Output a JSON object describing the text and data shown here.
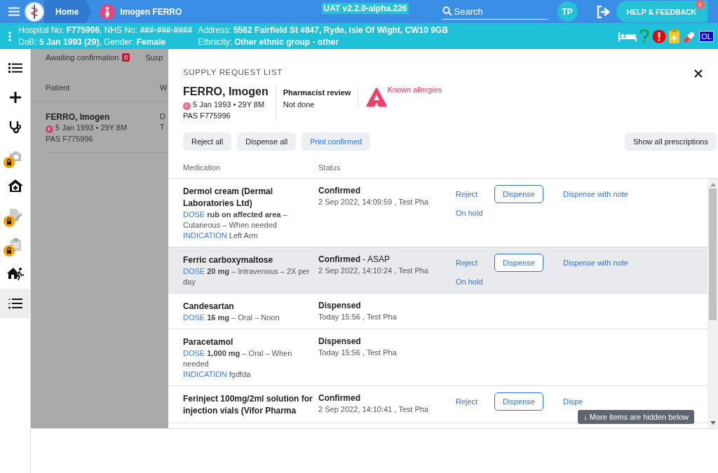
{
  "top_bar": {
    "home": "Home",
    "patient": "Imogen FERRO",
    "environment": "UAT v2.2.0-alpha.226",
    "search": {
      "placeholder": "Search"
    },
    "user_initials": "TP",
    "help_button": "HELP & FEEDBACK",
    "help_badge": "1"
  },
  "patient_banner": {
    "columns": [
      [
        "Hospital No: **F775996**, NHS No: **###-###-####**",
        "DoB: **5 Jan 1993 (29)**, Gender: **Female**"
      ],
      [
        "Address: **5562 Fairfield St #847, Ryde, Isle Of Wight, CW10 9GB**",
        "Ethnicity: **Other ethnic group - other**"
      ]
    ],
    "badge": "OL"
  },
  "sidebar": {
    "items": [
      {
        "kind": "list",
        "locked": false,
        "selected": false
      },
      {
        "kind": "plus",
        "locked": false,
        "selected": false
      },
      {
        "kind": "stethoscope",
        "locked": false,
        "selected": false
      },
      {
        "kind": "camera",
        "locked": true,
        "selected": false
      },
      {
        "kind": "hospital",
        "locked": false,
        "selected": false
      },
      {
        "kind": "edit",
        "locked": true,
        "selected": false
      },
      {
        "kind": "clipboard",
        "locked": true,
        "selected": false
      },
      {
        "kind": "exit",
        "locked": false,
        "selected": false
      },
      {
        "kind": "checklist",
        "locked": false,
        "selected": true
      }
    ]
  },
  "background_list": {
    "tabs": [
      {
        "label": "Awaiting confirmation",
        "count": "0"
      },
      {
        "label": "Susp"
      }
    ],
    "columns": [
      "Patient",
      "W"
    ],
    "rows": [
      {
        "name": "FERRO, Imogen",
        "sex": "F",
        "dob": "5 Jan 1993 • 29Y 8M",
        "pas": "PAS F775996",
        "column_2": [
          "D",
          "T"
        ]
      }
    ]
  },
  "supply_list": {
    "title": "SUPPLY REQUEST LIST",
    "patient": {
      "name": "FERRO, Imogen",
      "sex": "F",
      "dob": "5 Jan 1993 • 29Y 8M",
      "pas": "PAS F775996"
    },
    "review": {
      "label": "Pharmacist review",
      "value": "Not done"
    },
    "allergies": "Known allergies",
    "actions": [
      {
        "label": "Reject all",
        "kind": "plain"
      },
      {
        "label": "Dispense all",
        "kind": "plain"
      },
      {
        "label": "Print confirmed",
        "kind": "accent"
      }
    ],
    "show_all": "Show all prescriptions",
    "columns": [
      "Medication",
      "Status"
    ],
    "rows": [
      {
        "name": "Dermol cream (Dermal Laboratories Ltd)",
        "details": [
          {
            "label": "DOSE",
            "text": "**rub on affected area** – Cutaneous – When needed"
          },
          {
            "label": "INDICATION",
            "text": "Left Arm"
          }
        ],
        "status": "Confirmed",
        "timestamp": "2 Sep 2022, 14:09:59 , Test Pha",
        "selected": false,
        "actions": [
          {
            "label": "Reject",
            "kind": "link"
          },
          {
            "label": "Dispense",
            "kind": "outlined"
          },
          {
            "label": "Dispense with note",
            "kind": "link"
          },
          {
            "label": "On hold",
            "kind": "link"
          }
        ]
      },
      {
        "name": "Ferric carboxymaltose",
        "details": [
          {
            "label": "DOSE",
            "text": "**20 mg** – Intravenous – 2X per day"
          }
        ],
        "status": "Confirmed",
        "status_note": "- ASAP",
        "timestamp": "2 Sep 2022, 14:10:24 , Test Pha",
        "selected": true,
        "actions": [
          {
            "label": "Reject",
            "kind": "link"
          },
          {
            "label": "Dispense",
            "kind": "outlined"
          },
          {
            "label": "Dispense with note",
            "kind": "link"
          },
          {
            "label": "On hold",
            "kind": "link"
          }
        ]
      },
      {
        "name": "Candesartan",
        "details": [
          {
            "label": "DOSE",
            "text": "**16 mg** – Oral – Noon"
          }
        ],
        "status": "Dispensed",
        "timestamp": "Today 15:56 , Test Pha",
        "selected": false
      },
      {
        "name": "Paracetamol",
        "details": [
          {
            "label": "DOSE",
            "text": "**1,000 mg** – Oral – When needed"
          },
          {
            "label": "INDICATION",
            "text": "fgdfda"
          }
        ],
        "status": "Dispensed",
        "timestamp": "Today 15:56 , Test Pha",
        "selected": false
      },
      {
        "name": "Ferinject 100mg/2ml solution for injection vials (Vifor Pharma",
        "details": [],
        "status": "Confirmed",
        "timestamp": "2 Sep 2022, 14:10:41 , Test Pha",
        "selected": false,
        "actions": [
          {
            "label": "Reject",
            "kind": "link"
          },
          {
            "label": "Dispense",
            "kind": "outlined"
          },
          {
            "label": "Dispe",
            "kind": "link"
          }
        ]
      }
    ],
    "hint": "↓ More items are hidden below"
  }
}
